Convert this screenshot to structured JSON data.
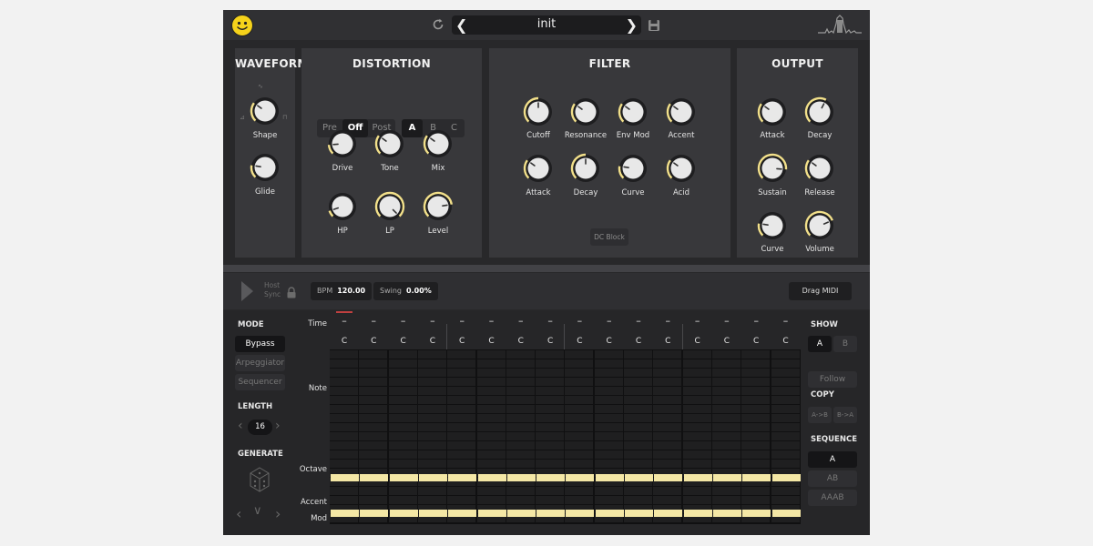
{
  "header": {
    "preset_name": "init"
  },
  "waveform": {
    "title": "WAVEFORM",
    "knobs": [
      {
        "label": "Shape",
        "value": 0.3
      },
      {
        "label": "Glide",
        "value": 0.2
      }
    ]
  },
  "distortion": {
    "title": "DISTORTION",
    "modes": [
      "Pre",
      "Off",
      "Post"
    ],
    "selected_mode": "Off",
    "slots": [
      "A",
      "B",
      "C"
    ],
    "selected_slot": "A",
    "knobs": [
      {
        "label": "Drive",
        "value": 0.15
      },
      {
        "label": "Tone",
        "value": 0.3
      },
      {
        "label": "Mix",
        "value": 0.3
      },
      {
        "label": "HP",
        "value": 0.1
      },
      {
        "label": "LP",
        "value": 1.0
      },
      {
        "label": "Level",
        "value": 0.8
      }
    ]
  },
  "filter": {
    "title": "FILTER",
    "knobs": [
      {
        "label": "Cutoff",
        "value": 0.5
      },
      {
        "label": "Resonance",
        "value": 0.3
      },
      {
        "label": "Env Mod",
        "value": 0.3
      },
      {
        "label": "Accent",
        "value": 0.3
      },
      {
        "label": "Attack",
        "value": 0.3
      },
      {
        "label": "Decay",
        "value": 0.5
      },
      {
        "label": "Curve",
        "value": 0.2
      },
      {
        "label": "Acid",
        "value": 0.3
      }
    ],
    "dc_block": "DC Block"
  },
  "output": {
    "title": "OUTPUT",
    "knobs": [
      {
        "label": "Attack",
        "value": 0.3
      },
      {
        "label": "Decay",
        "value": 0.6
      },
      {
        "label": "Sustain",
        "value": 0.85
      },
      {
        "label": "Release",
        "value": 0.3
      },
      {
        "label": "Curve",
        "value": 0.2
      },
      {
        "label": "Volume",
        "value": 0.75
      }
    ]
  },
  "transport": {
    "host_sync_line1": "Host",
    "host_sync_line2": "Sync",
    "bpm_label": "BPM",
    "bpm_value": "120.00",
    "swing_label": "Swing",
    "swing_value": "0.00%",
    "drag_midi": "Drag MIDI"
  },
  "left_panel": {
    "mode_title": "MODE",
    "modes": [
      "Bypass",
      "Arpeggiator",
      "Sequencer"
    ],
    "selected_mode": "Bypass",
    "length_title": "LENGTH",
    "length_value": "16",
    "generate_title": "GENERATE"
  },
  "sequencer": {
    "row_labels": {
      "time": "Time",
      "note": "Note",
      "octave": "Octave",
      "accent": "Accent",
      "mod": "Mod"
    },
    "steps": [
      {
        "time": "–",
        "note": "C"
      },
      {
        "time": "–",
        "note": "C"
      },
      {
        "time": "–",
        "note": "C"
      },
      {
        "time": "–",
        "note": "C"
      },
      {
        "time": "–",
        "note": "C"
      },
      {
        "time": "–",
        "note": "C"
      },
      {
        "time": "–",
        "note": "C"
      },
      {
        "time": "–",
        "note": "C"
      },
      {
        "time": "–",
        "note": "C"
      },
      {
        "time": "–",
        "note": "C"
      },
      {
        "time": "–",
        "note": "C"
      },
      {
        "time": "–",
        "note": "C"
      },
      {
        "time": "–",
        "note": "C"
      },
      {
        "time": "–",
        "note": "C"
      },
      {
        "time": "–",
        "note": "C"
      },
      {
        "time": "–",
        "note": "C"
      }
    ]
  },
  "right_panel": {
    "show_title": "SHOW",
    "show_options": [
      "A",
      "B"
    ],
    "show_selected": "A",
    "follow": "Follow",
    "copy_title": "COPY",
    "copy_options": [
      "A->B",
      "B->A"
    ],
    "sequence_title": "SEQUENCE",
    "sequence_options": [
      "A",
      "AB",
      "AAAB"
    ],
    "sequence_selected": "A"
  },
  "colors": {
    "accent": "#f2e08a",
    "note_block": "#f4e7a5",
    "background": "#28282a",
    "panel": "#38383b"
  }
}
